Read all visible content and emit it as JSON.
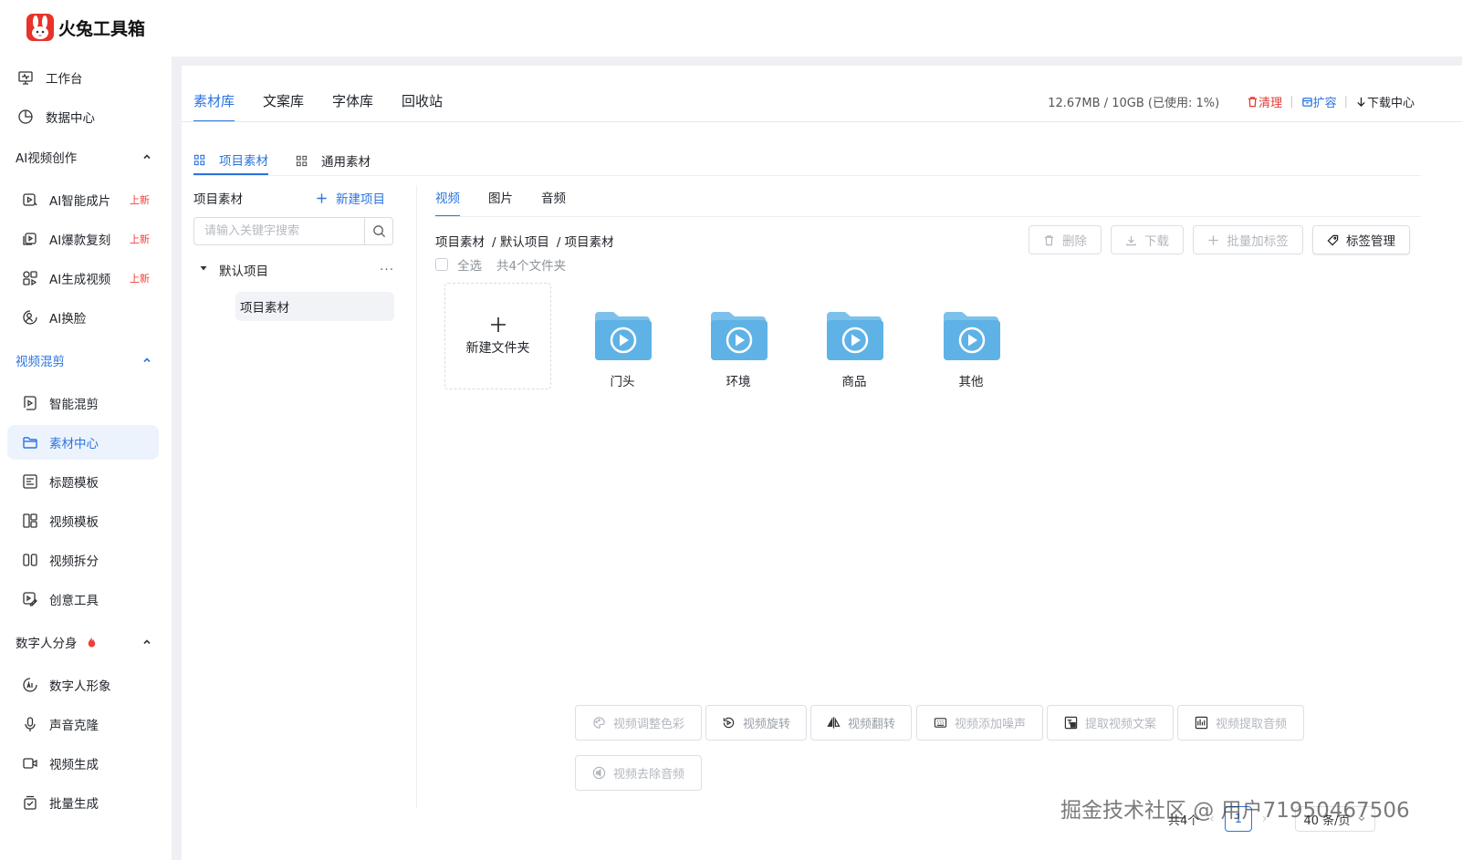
{
  "app": {
    "title": "火兔工具箱",
    "brand_color": "#e8332a",
    "accent_color": "#2b74e0"
  },
  "sidebar": {
    "top_items": [
      {
        "label": "工作台",
        "icon": "monitor-icon"
      },
      {
        "label": "数据中心",
        "icon": "pie-chart-icon"
      }
    ],
    "sections": [
      {
        "label": "AI视频创作",
        "items": [
          {
            "label": "AI智能成片",
            "badge": "上新",
            "icon": "ai-video-icon"
          },
          {
            "label": "AI爆款复刻",
            "badge": "上新",
            "icon": "copy-video-icon"
          },
          {
            "label": "AI生成视频",
            "badge": "上新",
            "icon": "generate-video-icon"
          },
          {
            "label": "AI换脸",
            "badge": "",
            "icon": "face-swap-icon"
          }
        ]
      },
      {
        "label": "视频混剪",
        "items": [
          {
            "label": "智能混剪",
            "icon": "smart-edit-icon"
          },
          {
            "label": "素材中心",
            "icon": "folder-icon",
            "active": true
          },
          {
            "label": "标题模板",
            "icon": "title-template-icon"
          },
          {
            "label": "视频模板",
            "icon": "video-template-icon"
          },
          {
            "label": "视频拆分",
            "icon": "split-icon"
          },
          {
            "label": "创意工具",
            "icon": "creative-tool-icon"
          }
        ]
      },
      {
        "label": "数字人分身",
        "items": [
          {
            "label": "数字人形象",
            "icon": "avatar-icon"
          },
          {
            "label": "声音克隆",
            "icon": "microphone-icon"
          },
          {
            "label": "视频生成",
            "icon": "camera-icon"
          },
          {
            "label": "批量生成",
            "icon": "batch-icon"
          }
        ]
      }
    ]
  },
  "library_tabs": [
    "素材库",
    "文案库",
    "字体库",
    "回收站"
  ],
  "storage": {
    "usage": "12.67MB / 10GB (已使用: 1%)",
    "clean": "清理",
    "expand": "扩容",
    "download_center": "下载中心"
  },
  "material_tabs": [
    "项目素材",
    "通用素材"
  ],
  "left_panel": {
    "title": "项目素材",
    "new_project": "新建项目",
    "search_placeholder": "请输入关键字搜索",
    "root": "默认项目",
    "more": "···",
    "child": "项目素材"
  },
  "media_tabs": [
    "视频",
    "图片",
    "音频"
  ],
  "breadcrumb": [
    "项目素材",
    "/ 默认项目",
    "/ 项目素材"
  ],
  "select_all": "全选",
  "folder_count": "共4个文件夹",
  "actions": {
    "delete": "删除",
    "download": "下载",
    "batch_tag": "批量加标签",
    "tag_manage": "标签管理"
  },
  "new_folder": "新建文件夹",
  "folders": [
    "门头",
    "环境",
    "商品",
    "其他"
  ],
  "tools": [
    "视频调整色彩",
    "视频旋转",
    "视频翻转",
    "视频添加噪声",
    "提取视频文案",
    "视频提取音频",
    "视频去除音频"
  ],
  "pagination": {
    "total": "共4个",
    "page": "1",
    "page_size": "40 条/页"
  },
  "watermark": "掘金技术社区 @ 用户71950467506"
}
